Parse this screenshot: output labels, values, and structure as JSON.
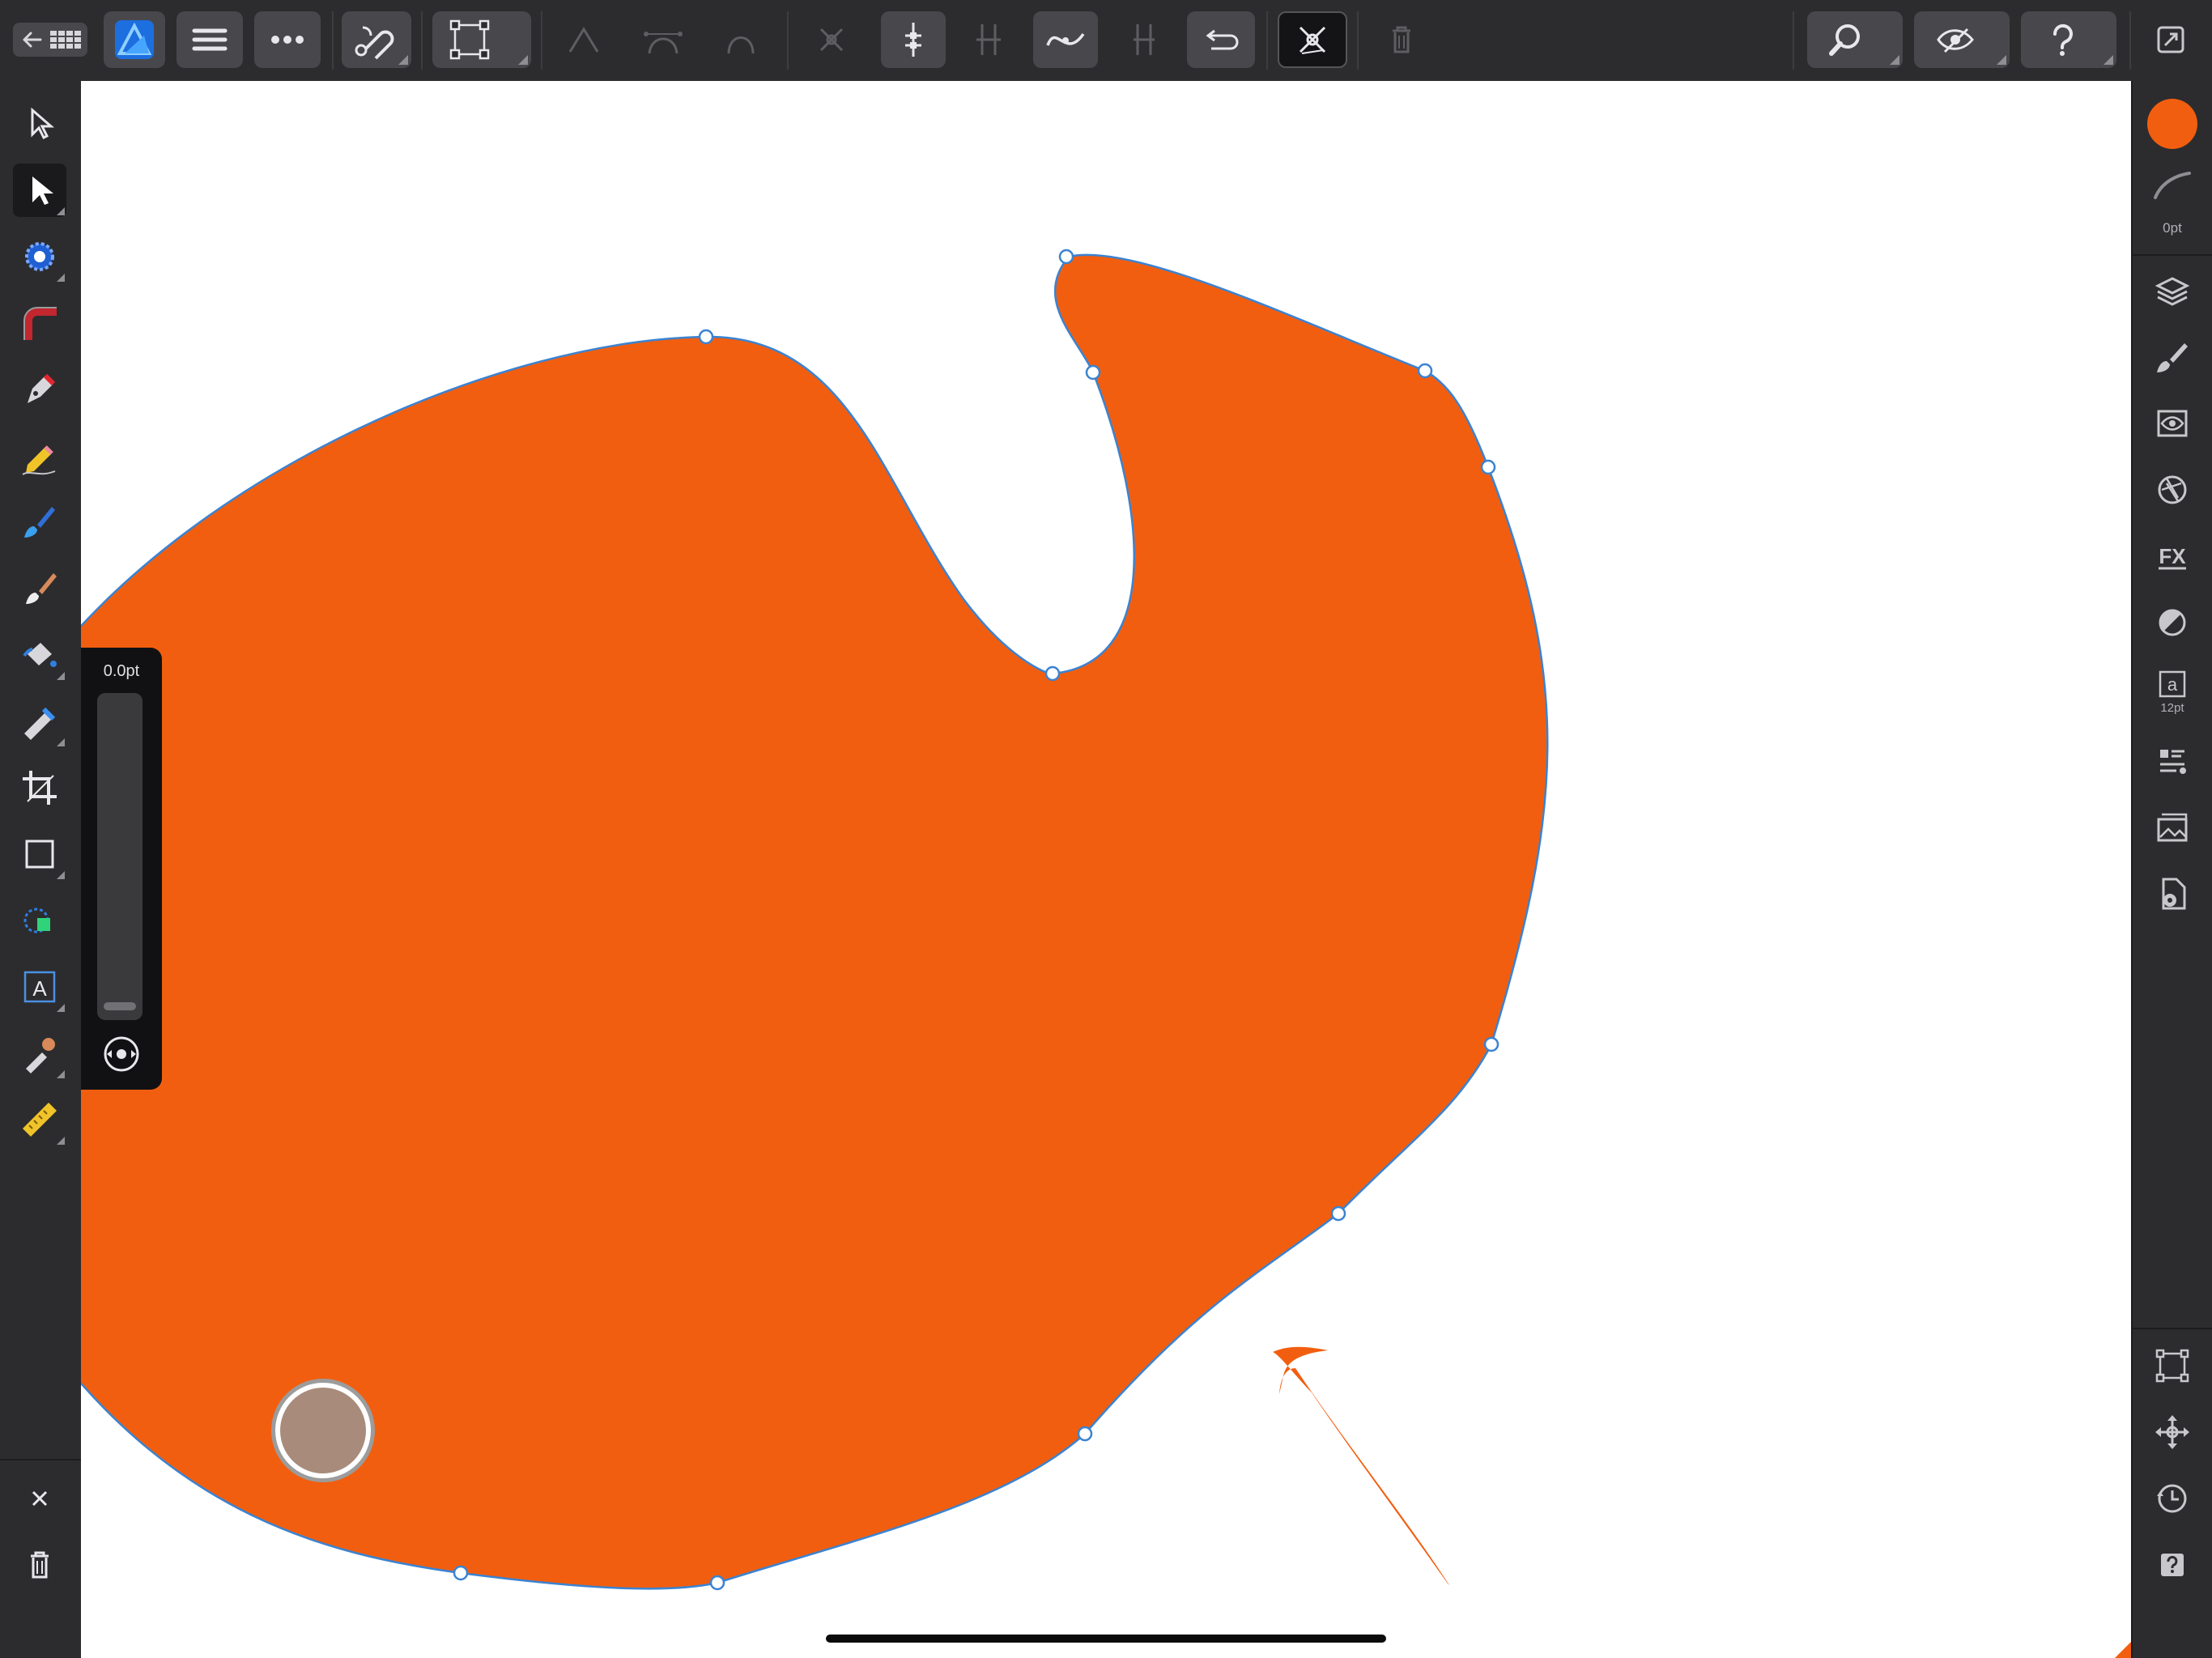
{
  "app": {
    "name": "Affinity Designer"
  },
  "toolbar": {
    "left": [
      {
        "name": "back-to-documents-button",
        "icon": "arrow-left-grid-icon"
      },
      {
        "name": "persona-designer-button",
        "icon": "affinity-designer-logo"
      },
      {
        "name": "menu-button",
        "icon": "hamburger-icon"
      },
      {
        "name": "more-button",
        "icon": "ellipsis-icon"
      },
      {
        "name": "snapping-button",
        "icon": "magnet-icon"
      },
      {
        "name": "transform-mode-button",
        "icon": "bounding-box-icon"
      }
    ],
    "context": [
      {
        "name": "sharp-corner-button",
        "icon": "sharp-node-icon",
        "enabled": false
      },
      {
        "name": "smooth-node-button",
        "icon": "smooth-node-icon",
        "enabled": false
      },
      {
        "name": "smart-node-button",
        "icon": "smart-node-icon",
        "enabled": false
      },
      {
        "name": "convert-node-button",
        "icon": "convert-icon",
        "enabled": false
      },
      {
        "name": "stabilizer-rope-button",
        "icon": "rope-icon",
        "enabled": true
      },
      {
        "name": "stabilizer-window-button",
        "icon": "window-icon",
        "enabled": false
      },
      {
        "name": "sculpt-button",
        "icon": "curve-icon",
        "enabled": true
      },
      {
        "name": "align-button",
        "icon": "align-icon",
        "enabled": false
      },
      {
        "name": "close-curve-button",
        "icon": "close-curve-icon",
        "enabled": true
      },
      {
        "name": "pressure-button",
        "icon": "pressure-icon",
        "enabled": true
      },
      {
        "name": "delete-node-button",
        "icon": "trash-icon",
        "enabled": false
      }
    ],
    "right": [
      {
        "name": "zoom-button",
        "icon": "magnifier-icon"
      },
      {
        "name": "view-mode-button",
        "icon": "eye-icon"
      },
      {
        "name": "help-button",
        "icon": "question-icon"
      },
      {
        "name": "export-button",
        "icon": "export-icon"
      }
    ]
  },
  "left_tools": [
    {
      "name": "move-tool",
      "icon": "arrow-outline-icon",
      "active": false
    },
    {
      "name": "node-tool",
      "icon": "arrow-solid-icon",
      "active": true
    },
    {
      "name": "point-transform-tool",
      "icon": "target-icon",
      "active": false
    },
    {
      "name": "corner-tool",
      "icon": "corner-icon",
      "active": false
    },
    {
      "name": "pen-tool",
      "icon": "pen-icon",
      "active": false
    },
    {
      "name": "pencil-tool",
      "icon": "pencil-icon",
      "active": false
    },
    {
      "name": "vector-brush-tool",
      "icon": "brush-icon",
      "active": false
    },
    {
      "name": "paint-brush-tool",
      "icon": "paint-brush-icon",
      "active": false
    },
    {
      "name": "fill-tool",
      "icon": "bucket-icon",
      "active": false
    },
    {
      "name": "transparency-tool",
      "icon": "gradient-icon",
      "active": false
    },
    {
      "name": "crop-tool",
      "icon": "crop-icon",
      "active": false
    },
    {
      "name": "rectangle-tool",
      "icon": "rectangle-icon",
      "active": false
    },
    {
      "name": "shape-builder-tool",
      "icon": "shapes-icon",
      "active": false
    },
    {
      "name": "text-tool",
      "icon": "text-frame-icon",
      "active": false
    },
    {
      "name": "color-picker-tool",
      "icon": "eyedropper-icon",
      "active": false
    },
    {
      "name": "measure-tool",
      "icon": "ruler-icon",
      "active": false
    }
  ],
  "left_bottom": [
    {
      "name": "deselect-button",
      "icon": "close-icon"
    },
    {
      "name": "delete-button",
      "icon": "trash-icon"
    }
  ],
  "right_panel": {
    "fill_color": "#f25e0f",
    "stroke_width_label": "0pt",
    "text_size_label": "12pt",
    "studios": [
      {
        "name": "layers-studio",
        "icon": "layers-icon"
      },
      {
        "name": "brushes-studio",
        "icon": "brush-icon"
      },
      {
        "name": "appearance-studio",
        "icon": "eye-panel-icon"
      },
      {
        "name": "adjustments-studio",
        "icon": "aperture-icon"
      },
      {
        "name": "effects-studio",
        "icon": "fx-icon"
      },
      {
        "name": "styles-studio",
        "icon": "style-icon"
      },
      {
        "name": "text-styles-studio",
        "icon": "text-a-icon"
      },
      {
        "name": "symbols-studio",
        "icon": "list-icon"
      },
      {
        "name": "assets-studio",
        "icon": "image-stack-icon"
      },
      {
        "name": "document-settings-studio",
        "icon": "document-gear-icon"
      }
    ],
    "bottom": [
      {
        "name": "transform-studio",
        "icon": "node-square-icon"
      },
      {
        "name": "navigator-studio",
        "icon": "move-arrows-icon"
      },
      {
        "name": "history-studio",
        "icon": "clock-icon"
      },
      {
        "name": "help-studio",
        "icon": "help-square-icon"
      }
    ]
  },
  "pressure_panel": {
    "value": "0.0pt"
  },
  "canvas": {
    "shape_fill": "#f25e0f",
    "selection_color": "#3b83d1"
  }
}
